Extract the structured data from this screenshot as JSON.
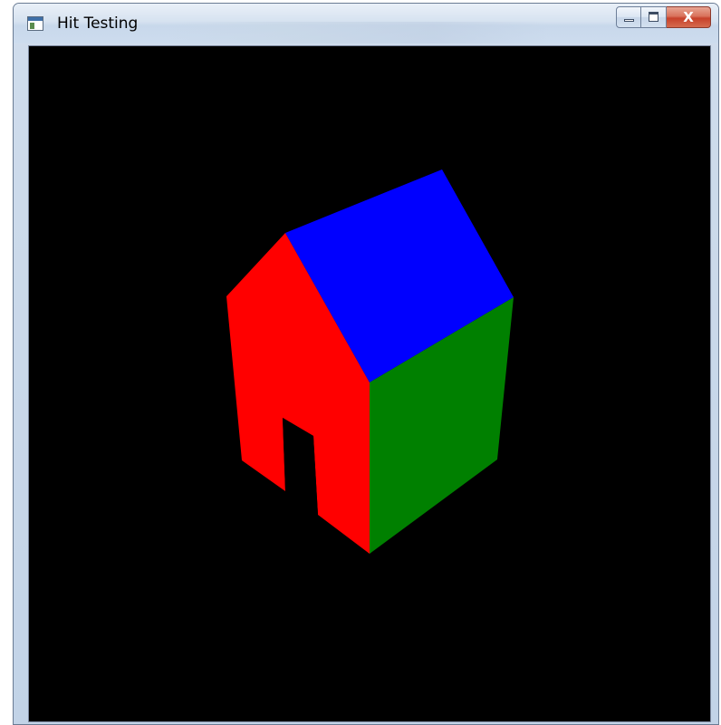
{
  "window": {
    "title": "Hit Testing",
    "app_icon": "window-app-icon",
    "controls": {
      "minimize_icon": "minimize-icon",
      "maximize_icon": "maximize-icon",
      "close_label": "X"
    }
  },
  "viewport": {
    "background_color": "#000000",
    "model": {
      "name": "house",
      "faces": [
        {
          "name": "front-wall",
          "color": "#ff0000"
        },
        {
          "name": "roof",
          "color": "#0000ff"
        },
        {
          "name": "side-wall",
          "color": "#008000"
        }
      ],
      "door_color": "#000000"
    }
  }
}
